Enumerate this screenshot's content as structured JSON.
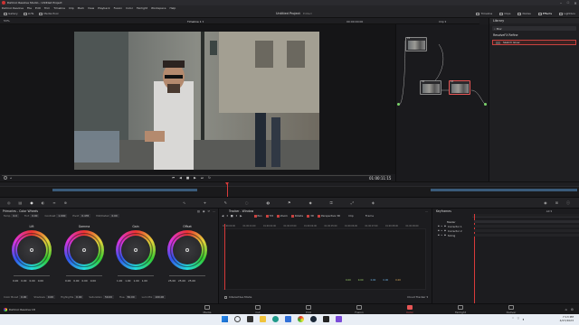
{
  "window": {
    "title": "DaVinci Resolve Studio - Untitled Project"
  },
  "menu": [
    "DaVinci Resolve",
    "File",
    "Edit",
    "Trim",
    "Timeline",
    "Clip",
    "Mark",
    "View",
    "Playback",
    "Fusion",
    "Color",
    "Fairlight",
    "Workspace",
    "Help"
  ],
  "toolbar": {
    "left": [
      "Gallery",
      "LUTs",
      "Media Pool"
    ],
    "center_title": "Untitled Project",
    "center_status": "Edited",
    "right": [
      "Timeline",
      "Clips",
      "Nodes",
      "Effects",
      "Lightbox"
    ]
  },
  "viewer_header": {
    "zoom": "53%",
    "timeline_name": "Timeline 1",
    "timecode": "00:00:00:00",
    "clip_mode": "Clip"
  },
  "viewer": {
    "timecode": "01:00:11:15"
  },
  "nodes": [
    {
      "label": "01"
    },
    {
      "label": "02"
    },
    {
      "label": "03"
    }
  ],
  "library": {
    "tab": "Library",
    "search_placeholder": "Blur",
    "section": "ResolveFX Refine",
    "item": "Sketch Glow"
  },
  "palette": {
    "wheels_title": "Primaries - Color Wheels",
    "params_row": [
      {
        "label": "Temp",
        "value": "0.0"
      },
      {
        "label": "Tint",
        "value": "0.00"
      },
      {
        "label": "Contrast",
        "value": "1.000"
      },
      {
        "label": "Pivot",
        "value": "0.435"
      },
      {
        "label": "Mid/Detail",
        "value": "0.00"
      }
    ],
    "wheels": [
      {
        "name": "Lift",
        "values": [
          "0.00",
          "0.00",
          "0.00",
          "0.00"
        ]
      },
      {
        "name": "Gamma",
        "values": [
          "0.00",
          "0.00",
          "0.00",
          "0.00"
        ]
      },
      {
        "name": "Gain",
        "values": [
          "1.00",
          "1.00",
          "1.00",
          "1.00"
        ]
      },
      {
        "name": "Offset",
        "values": [
          "25.00",
          "25.00",
          "25.00"
        ]
      }
    ],
    "bottom_row": [
      {
        "label": "Color Boost",
        "value": "0.00"
      },
      {
        "label": "Shadows",
        "value": "0.00"
      },
      {
        "label": "Highlights",
        "value": "0.00"
      },
      {
        "label": "Saturation",
        "value": "50.00"
      },
      {
        "label": "Hue",
        "value": "50.00"
      },
      {
        "label": "Lum Mix",
        "value": "100.00"
      }
    ]
  },
  "tracker": {
    "title": "Tracker - Window",
    "checks": [
      "Pan",
      "Tilt",
      "Zoom",
      "Rotate",
      "3D",
      "Perspective 3D"
    ],
    "mode": "Clip",
    "view": "Frame",
    "ruler": [
      "01:00:00:00",
      "01:00:01:00",
      "01:00:02:00",
      "01:00:03:00",
      "01:00:04:00",
      "01:00:05:00",
      "01:00:06:00",
      "01:00:07:00",
      "01:00:08:00",
      "01:00:09:00"
    ],
    "readouts": [
      "0.00",
      "0.00",
      "0.00",
      "0.00",
      "0.00"
    ],
    "footer_left": "Interactive Mode",
    "footer_right": "Cloud Tracker"
  },
  "keyframes": {
    "title": "Keyframes",
    "filter": "All",
    "rows": [
      "Master",
      "Corrector 1",
      "Corrector 2",
      "Sizing"
    ]
  },
  "pages": [
    {
      "label": "Media",
      "active": false
    },
    {
      "label": "Cut",
      "active": false
    },
    {
      "label": "Edit",
      "active": false
    },
    {
      "label": "Fusion",
      "active": false
    },
    {
      "label": "Color",
      "active": true
    },
    {
      "label": "Fairlight",
      "active": false
    },
    {
      "label": "Deliver",
      "active": false
    }
  ],
  "app_brand": "DaVinci Resolve 18",
  "taskbar": {
    "time": "7:13 PM",
    "date": "4/27/2023"
  },
  "colors": {
    "accent": "#e85555",
    "playhead": "#d83b3b",
    "bg": "#1c1c1f"
  }
}
